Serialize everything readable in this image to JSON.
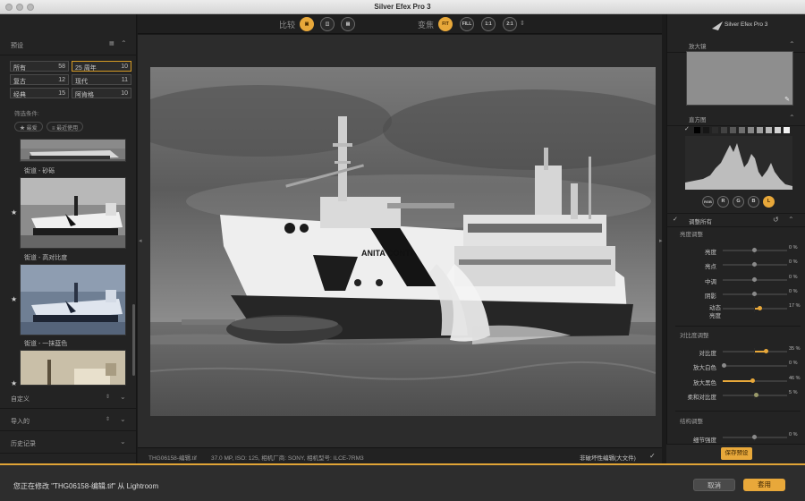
{
  "window": {
    "title": "Silver Efex Pro 3"
  },
  "left_panel": {
    "presets_label": "预设",
    "presets_view_icon": "grid-icon",
    "categories": [
      {
        "name": "所有",
        "count": "58",
        "selected": false
      },
      {
        "name": "25 周年",
        "count": "10",
        "selected": true
      },
      {
        "name": "复古",
        "count": "12",
        "selected": false
      },
      {
        "name": "现代",
        "count": "11",
        "selected": false
      },
      {
        "name": "经典",
        "count": "15",
        "selected": false
      },
      {
        "name": "阿肯格",
        "count": "10",
        "selected": false
      }
    ],
    "filter_label": "筛选条件:",
    "filters": [
      "★ 最爱",
      "≡ 最近使用"
    ],
    "presets": [
      {
        "label": "街道 - 砂砾",
        "starred": false
      },
      {
        "label": "街道 - 高对比度",
        "starred": true
      },
      {
        "label": "街道 - 一抹蓝色",
        "starred": true
      },
      {
        "label": "",
        "starred": true
      }
    ],
    "sections": [
      {
        "label": "自定义",
        "controls": "⇕"
      },
      {
        "label": "导入的",
        "controls": "⇕"
      },
      {
        "label": "历史记录",
        "controls": ""
      }
    ]
  },
  "toolbar": {
    "compare_label": "比较",
    "compare_buttons": [
      {
        "icon": "single-view-icon",
        "active": true
      },
      {
        "icon": "split-view-icon",
        "active": false
      },
      {
        "icon": "side-by-side-icon",
        "active": false
      }
    ],
    "zoom_label": "变焦",
    "zoom_buttons": [
      {
        "label": "FIT",
        "active": true
      },
      {
        "label": "FILL",
        "active": false
      },
      {
        "label": "1:1",
        "active": false
      },
      {
        "label": "2:1",
        "active": false
      }
    ],
    "zoom_stepper_icon": "stepper-icon"
  },
  "image": {
    "ship_name": "ANITA CONTI",
    "caption": "Black and white photo of a dredging ship spraying water"
  },
  "statusbar": {
    "filename": "THG06158-编辑.tif",
    "info": "37.0 MP, ISO: 125, 相机厂商: SONY, 相机型号: ILCE-7RM3",
    "mode": "非破坏性编辑(大文件)",
    "mode_check_icon": "check-icon"
  },
  "right_panel": {
    "logo_text": "Silver Efex Pro 3",
    "loupe_label": "放大镜",
    "histogram_label": "直方图",
    "histogram_channels": [
      "RGB",
      "R",
      "G",
      "B",
      "L"
    ],
    "active_channel": "L",
    "adjust_all_label": "调整所有",
    "groups": [
      {
        "label": "亮度调整",
        "sliders": [
          {
            "label": "亮度",
            "value": "0 %",
            "level": 0
          },
          {
            "label": "亮点",
            "value": "0 %",
            "level": 0
          },
          {
            "label": "中调",
            "value": "0 %",
            "level": 0
          },
          {
            "label": "阴影",
            "value": "0 %",
            "level": 0
          },
          {
            "label": "动态\n亮度",
            "value": "17 %",
            "level": 17
          }
        ]
      },
      {
        "label": "对比度调整",
        "sliders": [
          {
            "label": "对比度",
            "value": "35 %",
            "level": 35
          },
          {
            "label": "放大白色",
            "value": "0 %",
            "level": 0
          },
          {
            "label": "放大黑色",
            "value": "46 %",
            "level": 46
          },
          {
            "label": "柔和对比度",
            "value": "5 %",
            "level": 5
          }
        ]
      },
      {
        "label": "结构调整",
        "sliders": [
          {
            "label": "细节强度",
            "value": "0 %",
            "level": 0
          }
        ]
      }
    ],
    "save_preset_label": "保存预设"
  },
  "bottom_bar": {
    "message": "您正在修改 \"THG06158-编辑.tif\" 从 Lightroom",
    "cancel_label": "取消",
    "apply_label": "套用"
  },
  "colors": {
    "accent": "#e8a83a",
    "panel": "#232323",
    "canvas": "#2c2c2c"
  }
}
